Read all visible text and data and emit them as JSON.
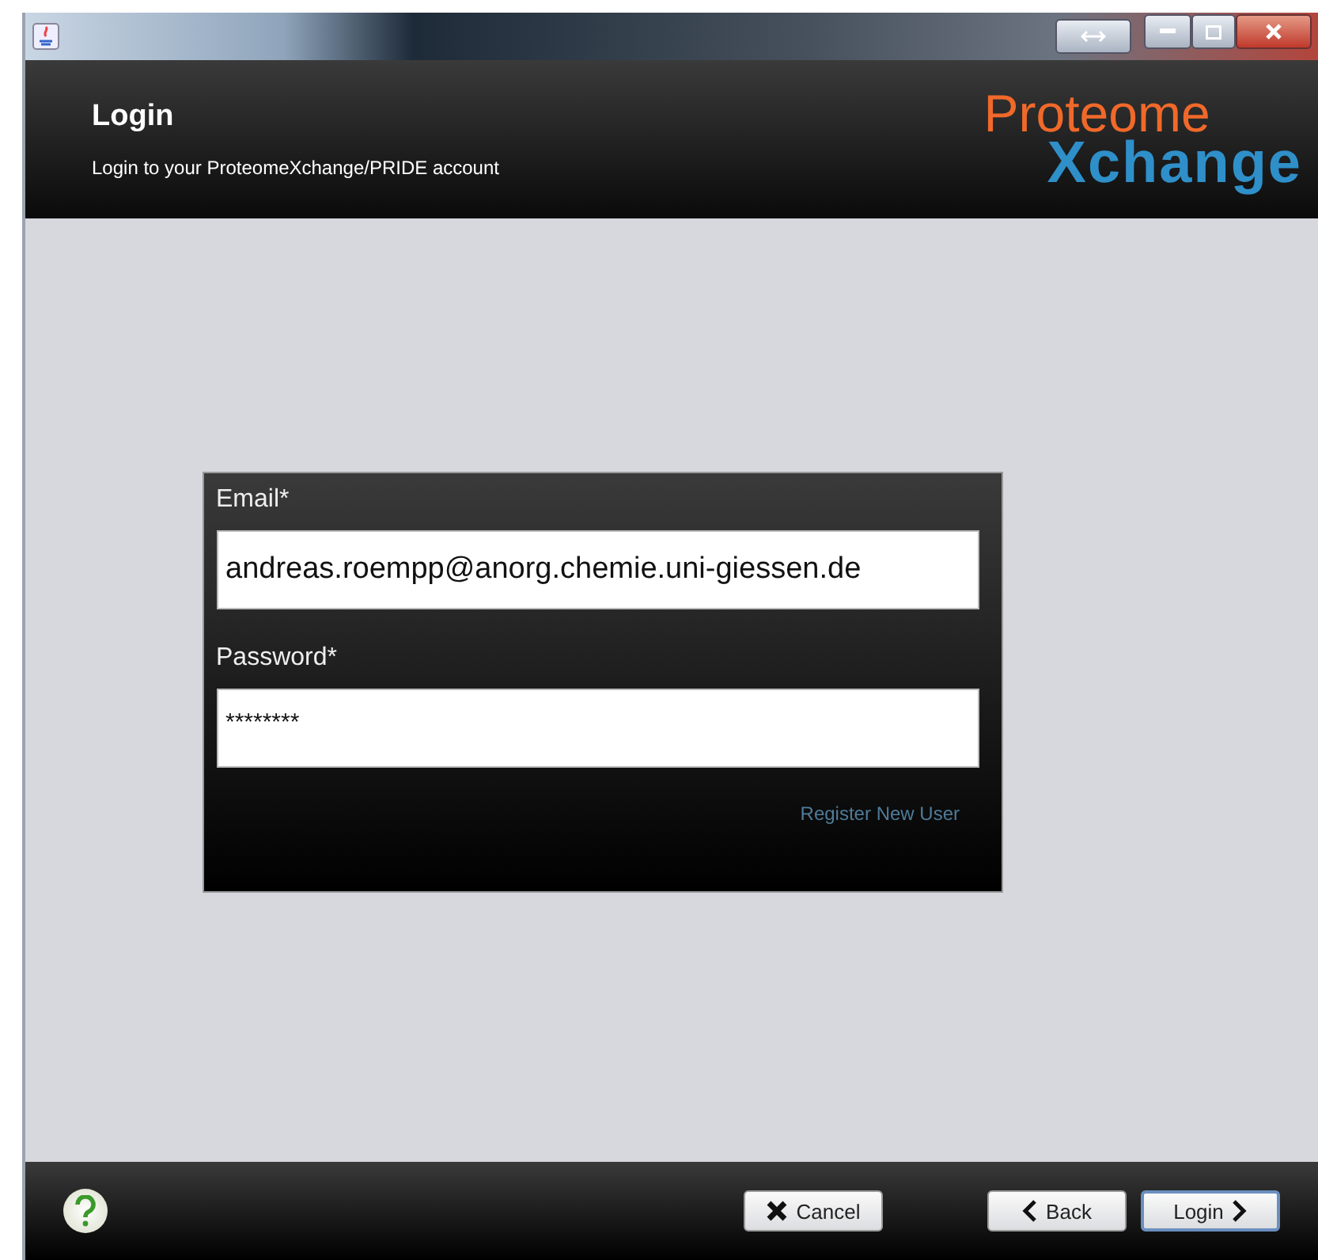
{
  "header": {
    "title": "Login",
    "subtitle": "Login to your ProteomeXchange/PRIDE account",
    "logo": {
      "top": "Proteome",
      "bottom": "Xchange"
    }
  },
  "form": {
    "fields": [
      {
        "label": "Email*",
        "value": "andreas.roempp@anorg.chemie.uni-giessen.de",
        "kind": "text"
      },
      {
        "label": "Password*",
        "value": "********",
        "kind": "password"
      }
    ],
    "link": "Register New User"
  },
  "footer": {
    "buttons": [
      {
        "label": "Cancel",
        "kind": "cancel",
        "focused": false
      },
      {
        "label": "Back",
        "kind": "back",
        "focused": false
      },
      {
        "label": "Login",
        "kind": "next",
        "focused": true
      }
    ]
  }
}
